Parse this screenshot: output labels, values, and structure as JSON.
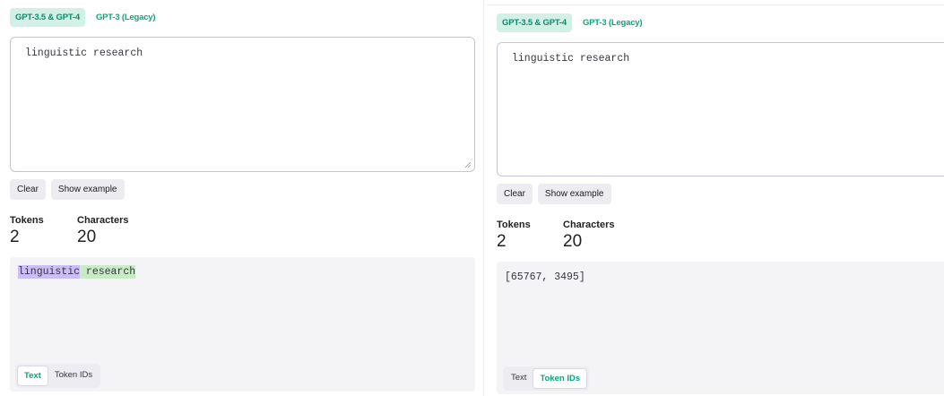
{
  "left": {
    "model_tabs": [
      {
        "label": "GPT-3.5 & GPT-4",
        "active": true
      },
      {
        "label": "GPT-3 (Legacy)",
        "active": false
      }
    ],
    "input_value": "linguistic research",
    "buttons": {
      "clear": "Clear",
      "show_example": "Show example"
    },
    "stats": {
      "tokens_label": "Tokens",
      "tokens_value": "2",
      "chars_label": "Characters",
      "chars_value": "20"
    },
    "output_tokens": [
      "linguistic",
      " research"
    ],
    "view_tabs": {
      "text": "Text",
      "token_ids": "Token IDs",
      "active": "text"
    }
  },
  "right": {
    "model_tabs": [
      {
        "label": "GPT-3.5 & GPT-4",
        "active": true
      },
      {
        "label": "GPT-3 (Legacy)",
        "active": false
      }
    ],
    "input_value": "linguistic research",
    "buttons": {
      "clear": "Clear",
      "show_example": "Show example"
    },
    "stats": {
      "tokens_label": "Tokens",
      "tokens_value": "2",
      "chars_label": "Characters",
      "chars_value": "20"
    },
    "output_token_ids": "[65767, 3495]",
    "view_tabs": {
      "text": "Text",
      "token_ids": "Token IDs",
      "active": "token_ids"
    }
  },
  "colors": {
    "accent": "#10a37f",
    "active_tab_bg": "#d2f0e6",
    "token_0": "#cbbdf5",
    "token_1": "#c6ebc5",
    "output_bg": "#f4f4f6"
  }
}
